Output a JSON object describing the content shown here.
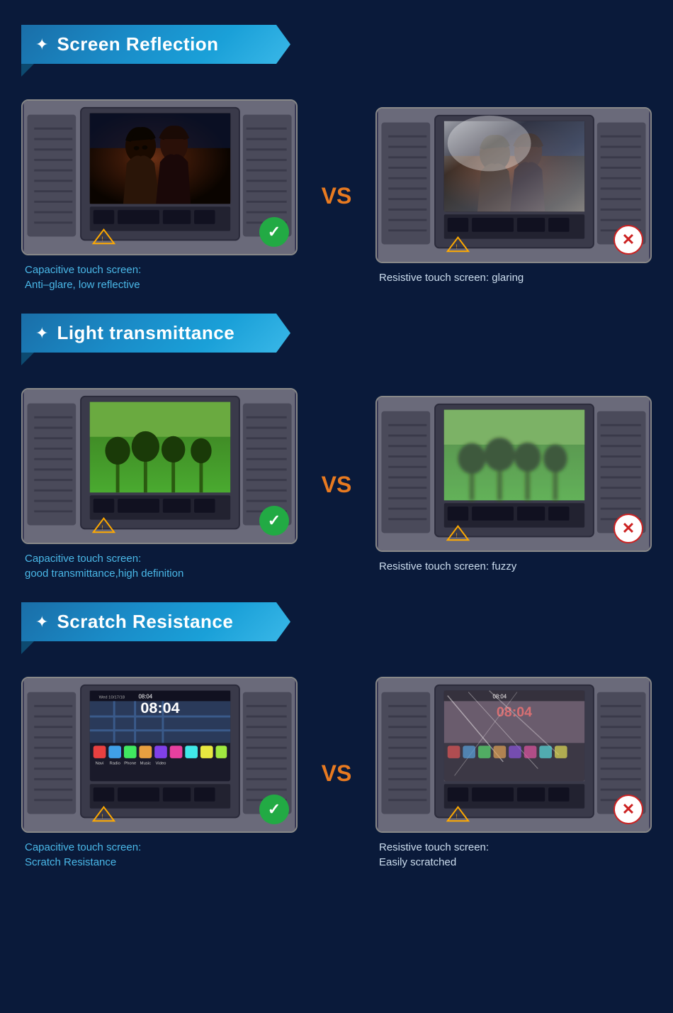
{
  "sections": [
    {
      "id": "screen-reflection",
      "title": "Screen Reflection",
      "icon": "✦",
      "left": {
        "type": "movie",
        "badge": "good",
        "caption_line1": "Capacitive touch screen:",
        "caption_line2": "Anti–glare, low reflective"
      },
      "right": {
        "type": "movie-glare",
        "badge": "bad",
        "caption_line1": "Resistive touch screen: glaring",
        "caption_line2": ""
      }
    },
    {
      "id": "light-transmittance",
      "title": "Light transmittance",
      "icon": "✦",
      "left": {
        "type": "plants",
        "badge": "good",
        "caption_line1": "Capacitive touch screen:",
        "caption_line2": "good transmittance,high definition"
      },
      "right": {
        "type": "plants-fuzzy",
        "badge": "bad",
        "caption_line1": "Resistive touch screen: fuzzy",
        "caption_line2": ""
      }
    },
    {
      "id": "scratch-resistance",
      "title": "Scratch Resistance",
      "icon": "✦",
      "left": {
        "type": "android",
        "badge": "good",
        "caption_line1": "Capacitive touch screen:",
        "caption_line2": "Scratch Resistance"
      },
      "right": {
        "type": "android-scratch",
        "badge": "bad",
        "caption_line1": "Resistive touch screen:",
        "caption_line2": "Easily scratched"
      }
    }
  ],
  "vs_label": "VS",
  "badge_good": "✓",
  "badge_bad": "✕",
  "android_time": "08:04",
  "android_date": "Wed 10/17/18"
}
